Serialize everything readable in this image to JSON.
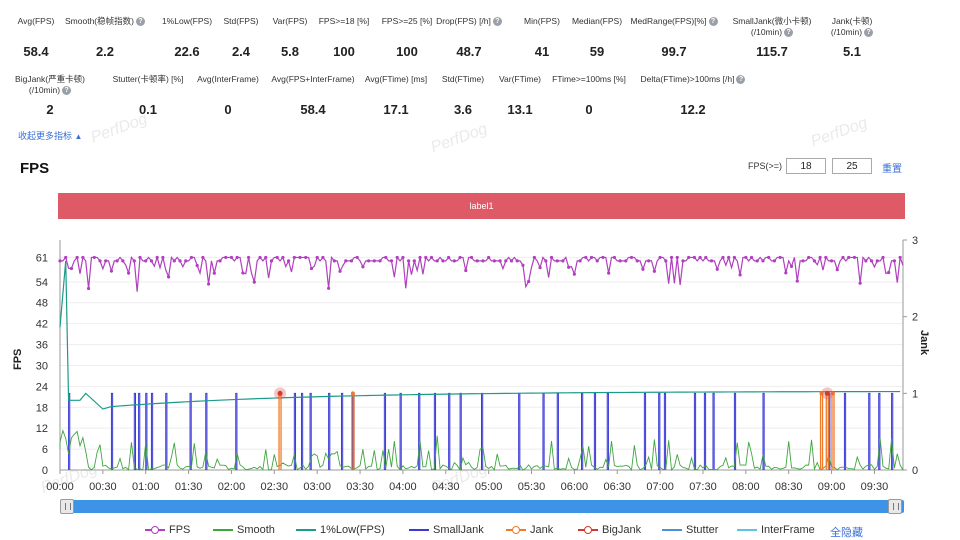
{
  "stats_row1": [
    {
      "label": "Avg(FPS)",
      "value": "58.4",
      "help": false
    },
    {
      "label": "Smooth(稳帧指数)",
      "value": "2.2",
      "help": true
    },
    {
      "label": "1%Low(FPS)",
      "value": "22.6",
      "help": false
    },
    {
      "label": "Std(FPS)",
      "value": "2.4",
      "help": false
    },
    {
      "label": "Var(FPS)",
      "value": "5.8",
      "help": false
    },
    {
      "label": "FPS>=18 [%]",
      "value": "100",
      "help": false
    },
    {
      "label": "FPS>=25 [%]",
      "value": "100",
      "help": false
    },
    {
      "label": "Drop(FPS) [/h]",
      "value": "48.7",
      "help": true
    },
    {
      "label": "Min(FPS)",
      "value": "41",
      "help": false
    },
    {
      "label": "Median(FPS)",
      "value": "59",
      "help": false
    },
    {
      "label": "MedRange(FPS)[%]",
      "value": "99.7",
      "help": true
    },
    {
      "label": "SmallJank(微小卡顿)",
      "label2": "(/10min)",
      "value": "115.7",
      "help": true
    },
    {
      "label": "Jank(卡顿)",
      "label2": "(/10min)",
      "value": "5.1",
      "help": true
    }
  ],
  "stats_row2": [
    {
      "label": "BigJank(严重卡顿)",
      "label2": "(/10min)",
      "value": "2",
      "help": true
    },
    {
      "label": "Stutter(卡顿率) [%]",
      "value": "0.1",
      "help": false
    },
    {
      "label": "Avg(InterFrame)",
      "value": "0",
      "help": false
    },
    {
      "label": "Avg(FPS+InterFrame)",
      "value": "58.4",
      "help": false
    },
    {
      "label": "Avg(FTime) [ms]",
      "value": "17.1",
      "help": false
    },
    {
      "label": "Std(FTime)",
      "value": "3.6",
      "help": false
    },
    {
      "label": "Var(FTime)",
      "value": "13.1",
      "help": false
    },
    {
      "label": "FTime>=100ms [%]",
      "value": "0",
      "help": false
    },
    {
      "label": "Delta(FTime)>100ms [/h]",
      "value": "12.2",
      "help": true
    }
  ],
  "collapse_label": "收起更多指标",
  "fps_section": {
    "title": "FPS",
    "threshold_label": "FPS(>=)",
    "threshold_1": "18",
    "threshold_2": "25",
    "reset_label": "重置",
    "label_bar": "label1"
  },
  "chart_data": {
    "type": "line",
    "ylabel_left": "FPS",
    "ylabel_right": "Jank",
    "y_left_ticks": [
      "61",
      "54",
      "48",
      "42",
      "36",
      "30",
      "24",
      "18",
      "12",
      "6",
      "0"
    ],
    "y_right_ticks": [
      "3",
      "2",
      "1",
      "0"
    ],
    "x_ticks": [
      "00:00",
      "00:30",
      "01:00",
      "01:30",
      "02:00",
      "02:30",
      "03:00",
      "03:30",
      "04:00",
      "04:30",
      "05:00",
      "05:30",
      "06:00",
      "06:30",
      "07:00",
      "07:30",
      "08:00",
      "08:30",
      "09:00",
      "09:30"
    ],
    "ylim_left": [
      0,
      66
    ],
    "ylim_right": [
      0,
      3
    ],
    "fps_baseline": 60,
    "fps_min": 41,
    "fps_min_time": "00:15",
    "onepercent_low_final": 22.6,
    "bigjank_times": [
      "02:34",
      "08:57"
    ],
    "jank_times": [
      "02:34",
      "03:25",
      "08:53",
      "08:57",
      "09:01"
    ],
    "series": [
      {
        "name": "FPS",
        "color": "#b13fbf"
      },
      {
        "name": "Smooth",
        "color": "#3fa63f"
      },
      {
        "name": "1%Low(FPS)",
        "color": "#1d9a8a"
      },
      {
        "name": "SmallJank",
        "color": "#3a3ad8"
      },
      {
        "name": "Jank",
        "color": "#f07a28"
      },
      {
        "name": "BigJank",
        "color": "#d23a2a"
      },
      {
        "name": "Stutter",
        "color": "#4a8fe0"
      },
      {
        "name": "InterFrame",
        "color": "#5cc6e0"
      }
    ]
  },
  "legend_hide_all": "全隐藏",
  "watermark": "PerfDog"
}
